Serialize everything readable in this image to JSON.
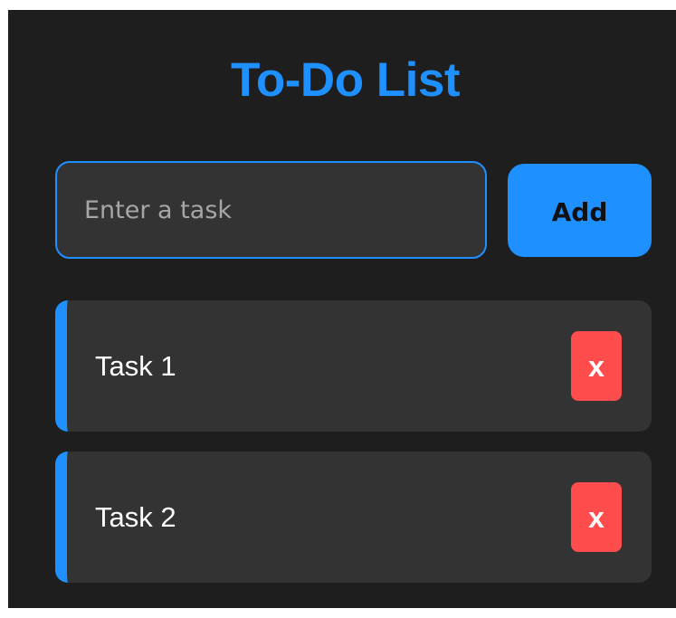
{
  "app": {
    "title": "To-Do List"
  },
  "input": {
    "value": "",
    "placeholder": "Enter a task"
  },
  "buttons": {
    "add_label": "Add",
    "delete_label": "x"
  },
  "tasks": [
    {
      "text": "Task 1"
    },
    {
      "text": "Task 2"
    }
  ],
  "colors": {
    "background": "#1e1e1e",
    "accent": "#1e90ff",
    "card": "#333333",
    "delete": "#ff4d4d",
    "text": "#ffffff"
  }
}
